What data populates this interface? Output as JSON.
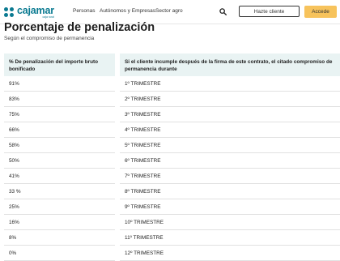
{
  "header": {
    "logo": {
      "text": "cajamar",
      "subtext": "caja rural"
    },
    "nav": [
      "Personas",
      "Autónomos y Empresas",
      "Sector agro"
    ],
    "search_icon": "search-icon",
    "signup_label": "Hazte cliente",
    "login_label": "Accede"
  },
  "colors": {
    "brand": "#0a7a91",
    "header_fill": "#e9f3f3",
    "cta": "#f7c35c"
  },
  "page": {
    "title": "Porcentaje de penalización",
    "subtitle": "Según el compromiso de permanencia"
  },
  "table": {
    "headers": [
      "% De penalización del importe bruto bonificado",
      "Si el cliente incumple después de la firma de este contrato, el citado compromiso de permanencia durante"
    ],
    "rows": [
      [
        "91%",
        "1º TRIMESTRE"
      ],
      [
        "83%",
        "2º TRIMESTRE"
      ],
      [
        "75%",
        "3º TRIMESTRE"
      ],
      [
        "66%",
        "4º TRIMESTRE"
      ],
      [
        "58%",
        "5º TRIMESTRE"
      ],
      [
        "50%",
        "6º TRIMESTRE"
      ],
      [
        "41%",
        "7º TRIMESTRE"
      ],
      [
        "33 %",
        "8º TRIMESTRE"
      ],
      [
        "25%",
        "9º TRIMESTRE"
      ],
      [
        "16%",
        "10º TRIMESTRE"
      ],
      [
        "8%",
        "11º TRIMESTRE"
      ],
      [
        "0%",
        "12º TRIMESTRE"
      ]
    ]
  }
}
